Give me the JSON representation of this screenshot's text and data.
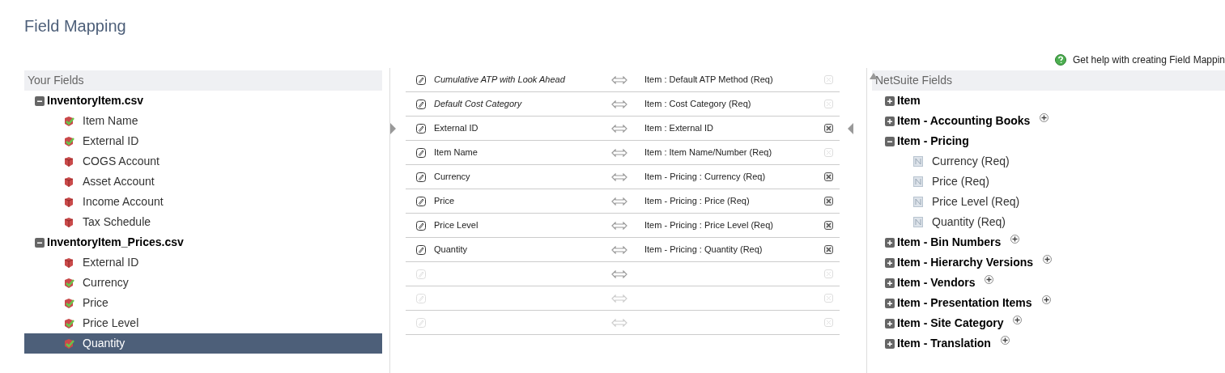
{
  "page_title": "Field Mapping",
  "help_link": "Get help with creating Field Mappin",
  "your_fields": {
    "title": "Your Fields",
    "files": [
      {
        "name": "InventoryItem.csv",
        "expanded": true,
        "fields": [
          {
            "label": "Item Name",
            "mapped": true,
            "selected": false
          },
          {
            "label": "External ID",
            "mapped": true,
            "selected": false
          },
          {
            "label": "COGS Account",
            "mapped": false,
            "selected": false
          },
          {
            "label": "Asset Account",
            "mapped": false,
            "selected": false
          },
          {
            "label": "Income Account",
            "mapped": false,
            "selected": false
          },
          {
            "label": "Tax Schedule",
            "mapped": false,
            "selected": false
          }
        ]
      },
      {
        "name": "InventoryItem_Prices.csv",
        "expanded": true,
        "fields": [
          {
            "label": "External ID",
            "mapped": false,
            "selected": false
          },
          {
            "label": "Currency",
            "mapped": true,
            "selected": false
          },
          {
            "label": "Price",
            "mapped": true,
            "selected": false
          },
          {
            "label": "Price Level",
            "mapped": true,
            "selected": false
          },
          {
            "label": "Quantity",
            "mapped": true,
            "selected": true
          }
        ]
      }
    ]
  },
  "mappings": [
    {
      "kind": "default",
      "source": "Cumulative ATP with Look Ahead",
      "target": "Item : Default ATP Method (Req)",
      "removable": false,
      "arrow_active": true
    },
    {
      "kind": "default",
      "source": "Default Cost Category",
      "target": "Item : Cost Category (Req)",
      "removable": false,
      "arrow_active": true
    },
    {
      "kind": "field",
      "source": "External ID",
      "target": "Item : External ID",
      "removable": true,
      "arrow_active": true
    },
    {
      "kind": "field",
      "source": "Item Name",
      "target": "Item : Item Name/Number (Req)",
      "removable": false,
      "arrow_active": true
    },
    {
      "kind": "field",
      "source": "Currency",
      "target": "Item - Pricing : Currency (Req)",
      "removable": true,
      "arrow_active": true
    },
    {
      "kind": "field",
      "source": "Price",
      "target": "Item - Pricing : Price (Req)",
      "removable": true,
      "arrow_active": true
    },
    {
      "kind": "field",
      "source": "Price Level",
      "target": "Item - Pricing : Price Level (Req)",
      "removable": true,
      "arrow_active": true
    },
    {
      "kind": "field",
      "source": "Quantity",
      "target": "Item - Pricing : Quantity (Req)",
      "removable": true,
      "arrow_active": true
    },
    {
      "kind": "empty",
      "removable": false,
      "arrow_active": true
    },
    {
      "kind": "empty",
      "removable": false,
      "arrow_active": false
    },
    {
      "kind": "empty",
      "removable": false,
      "arrow_active": false
    }
  ],
  "netsuite_fields": {
    "title": "NetSuite Fields",
    "groups": [
      {
        "label": "Item",
        "expanded": false,
        "addable": false
      },
      {
        "label": "Item - Accounting Books",
        "expanded": false,
        "addable": true
      },
      {
        "label": "Item - Pricing",
        "expanded": true,
        "addable": false,
        "children": [
          {
            "label": "Currency (Req)"
          },
          {
            "label": "Price (Req)"
          },
          {
            "label": "Price Level (Req)"
          },
          {
            "label": "Quantity (Req)"
          }
        ]
      },
      {
        "label": "Item - Bin Numbers",
        "expanded": false,
        "addable": true
      },
      {
        "label": "Item - Hierarchy Versions",
        "expanded": false,
        "addable": true
      },
      {
        "label": "Item - Vendors",
        "expanded": false,
        "addable": true
      },
      {
        "label": "Item - Presentation Items",
        "expanded": false,
        "addable": true
      },
      {
        "label": "Item - Site Category",
        "expanded": false,
        "addable": true
      },
      {
        "label": "Item - Translation",
        "expanded": false,
        "addable": true
      }
    ]
  }
}
